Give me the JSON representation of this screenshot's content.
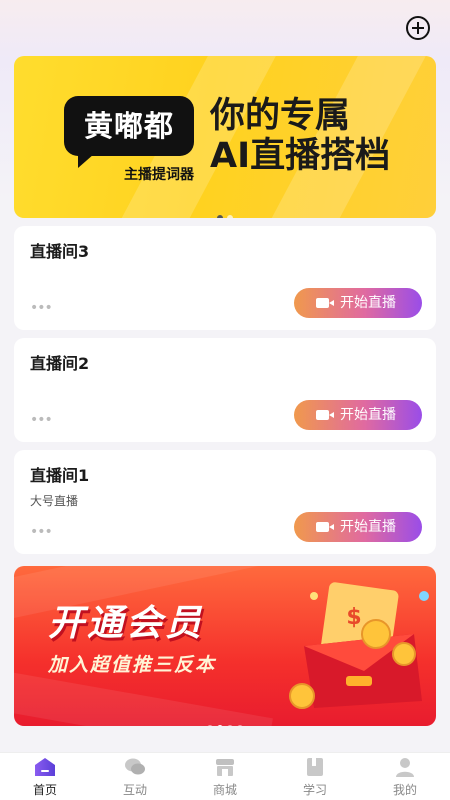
{
  "header": {
    "add_icon": "plus-circle-icon"
  },
  "hero_banner": {
    "logo_text": "黄嘟都",
    "logo_sub": "主播提词器",
    "title": "你的专属",
    "subtitle": "AI直播搭档",
    "active_slide": 1,
    "slide_count": 2
  },
  "rooms": [
    {
      "title": "直播间3",
      "description": "",
      "more": "•••",
      "button_label": "开始直播"
    },
    {
      "title": "直播间2",
      "description": "",
      "more": "•••",
      "button_label": "开始直播"
    },
    {
      "title": "直播间1",
      "description": "大号直播",
      "more": "•••",
      "button_label": "开始直播"
    }
  ],
  "promo_banner": {
    "title": "开通会员",
    "subtitle": "加入超值推三反本",
    "active_slide": 2,
    "slide_count": 4
  },
  "tabs": [
    {
      "label": "首页",
      "icon": "home-icon",
      "active": true
    },
    {
      "label": "互动",
      "icon": "chat-bubbles-icon",
      "active": false
    },
    {
      "label": "商城",
      "icon": "store-icon",
      "active": false
    },
    {
      "label": "学习",
      "icon": "book-icon",
      "active": false
    },
    {
      "label": "我的",
      "icon": "user-icon",
      "active": false
    }
  ],
  "colors": {
    "accent_gradient": [
      "#f0994d",
      "#e06aa0",
      "#9a4de8"
    ],
    "hero_yellow": "#ffd21f",
    "promo_red": "#f5302c",
    "tab_active": "#6b4de0"
  }
}
